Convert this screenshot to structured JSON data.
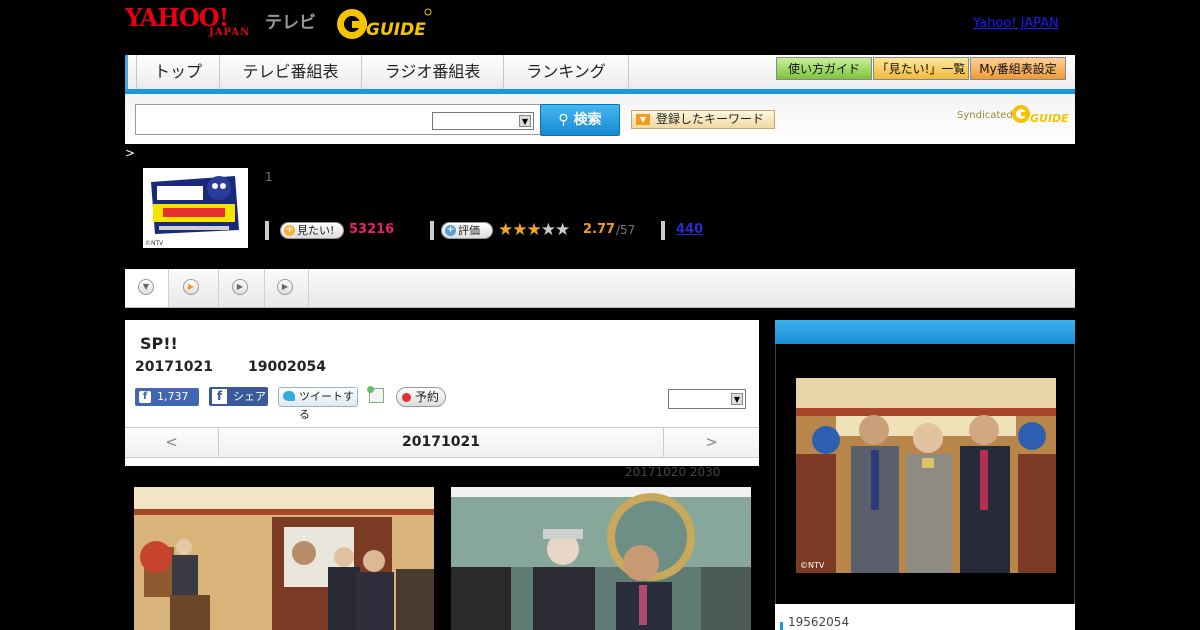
{
  "header": {
    "yahoo_logo": "YAHOO!",
    "yahoo_japan": "JAPAN",
    "tv_label": "テレビ",
    "gguide_logo": "G-GUIDE",
    "yahoo_japan_link": "Yahoo! JAPAN"
  },
  "nav": {
    "tabs": [
      {
        "label": "トップ"
      },
      {
        "label": "テレビ番組表"
      },
      {
        "label": "ラジオ番組表"
      },
      {
        "label": "ランキング"
      }
    ],
    "buttons": [
      {
        "label": "使い方ガイド"
      },
      {
        "label": "「見たい!」一覧"
      },
      {
        "label": "My番組表設定"
      }
    ]
  },
  "search": {
    "button_label": "検索",
    "keyword_button": "登録したキーワード",
    "syndicated": "Syndicated"
  },
  "breadcrumb": ">",
  "program": {
    "number": "1",
    "mitai_label": "見たい!",
    "mitai_count": "53216",
    "rate_label": "評価",
    "rating_value": 2.77,
    "rating_text": "2.77",
    "rating_total": "/57",
    "review_count": "440",
    "thumb_credit": "©NTV"
  },
  "episode": {
    "title": "SP!!",
    "date": "20171021",
    "time": "19002054",
    "fb_like_count": "1,737",
    "fb_share_label": "シェア",
    "tweet_label": "ツイートする",
    "reserve_label": "予約",
    "prev": "<",
    "nav_date": "20171021",
    "next": ">",
    "aired": "20171020  2030"
  },
  "side": {
    "count": "19562054",
    "photo_credit": "©NTV"
  },
  "colors": {
    "accent": "#1f95dc",
    "yahoo_red": "#e60012",
    "mitai_pink": "#e8206a",
    "rating_orange": "#f39a1e"
  }
}
